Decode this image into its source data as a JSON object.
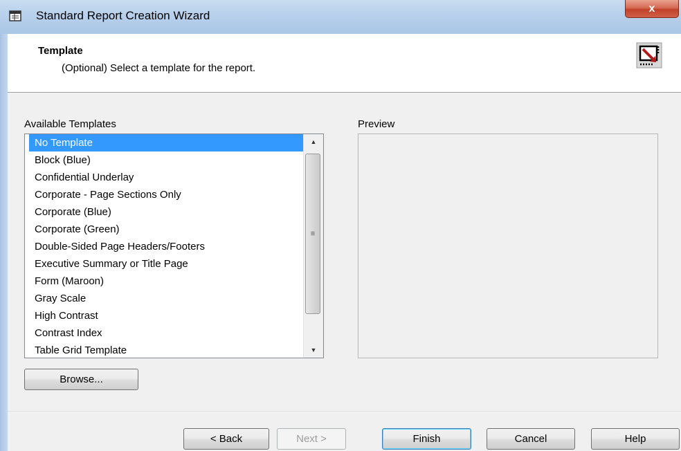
{
  "window": {
    "title": "Standard Report Creation Wizard",
    "close_label": "x"
  },
  "header": {
    "title": "Template",
    "subtitle": "(Optional) Select a template for the report."
  },
  "templates": {
    "label": "Available Templates",
    "items": [
      "No Template",
      "Block (Blue)",
      "Confidential Underlay",
      "Corporate - Page Sections Only",
      "Corporate (Blue)",
      "Corporate (Green)",
      "Double-Sided Page Headers/Footers",
      "Executive Summary or Title Page",
      "Form (Maroon)",
      "Gray Scale",
      "High Contrast",
      "Contrast Index",
      "Table Grid Template"
    ],
    "selected_index": 0
  },
  "preview": {
    "label": "Preview"
  },
  "buttons": {
    "browse": "Browse...",
    "back": "< Back",
    "next": "Next >",
    "finish": "Finish",
    "cancel": "Cancel",
    "help": "Help"
  },
  "colors": {
    "selection": "#3399ff",
    "titlebar": "#b9d1ec",
    "close": "#c2412a"
  },
  "icons": {
    "app": "report-app-icon",
    "wizard": "wizard-template-icon",
    "scroll_up": "up-arrow-icon",
    "scroll_down": "down-arrow-icon"
  }
}
